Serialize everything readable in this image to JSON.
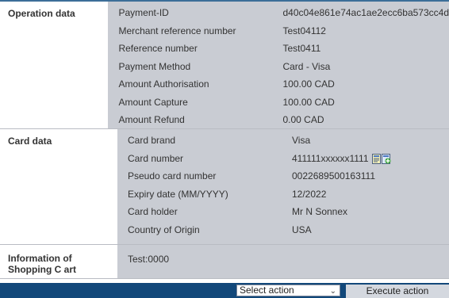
{
  "sections": {
    "operation": {
      "title": "Operation data",
      "rows": [
        {
          "label": "Payment-ID",
          "value": "d40c04e861e74ac1ae2ecc6ba573cc4d"
        },
        {
          "label": "Merchant reference number",
          "value": "Test04112"
        },
        {
          "label": "Reference number",
          "value": "Test0411"
        },
        {
          "label": "Payment Method",
          "value": "Card - Visa"
        },
        {
          "label": "Amount Authorisation",
          "value": "100.00 CAD"
        },
        {
          "label": "Amount Capture",
          "value": "100.00 CAD"
        },
        {
          "label": "Amount Refund",
          "value": "0.00 CAD"
        }
      ]
    },
    "card": {
      "title": "Card data",
      "rows": [
        {
          "label": "Card brand",
          "value": "Visa"
        },
        {
          "label": "Card number",
          "value": "411111xxxxxx1111"
        },
        {
          "label": "Pseudo card number",
          "value": "0022689500163111"
        },
        {
          "label": "Expiry date (MM/YYYY)",
          "value": "12/2022"
        },
        {
          "label": "Card holder",
          "value": "Mr N Sonnex"
        },
        {
          "label": "Country of Origin",
          "value": "USA"
        }
      ],
      "icons": [
        "copy-card-icon",
        "add-card-icon"
      ]
    },
    "shopping": {
      "title": "Information of Shopping C art",
      "value": "Test:0000"
    }
  },
  "footer": {
    "select_value": "Select action",
    "execute_label": "Execute action"
  },
  "colors": {
    "panel": "#c9ccd3",
    "footer": "#12487a",
    "top_border": "#3c6e98"
  }
}
